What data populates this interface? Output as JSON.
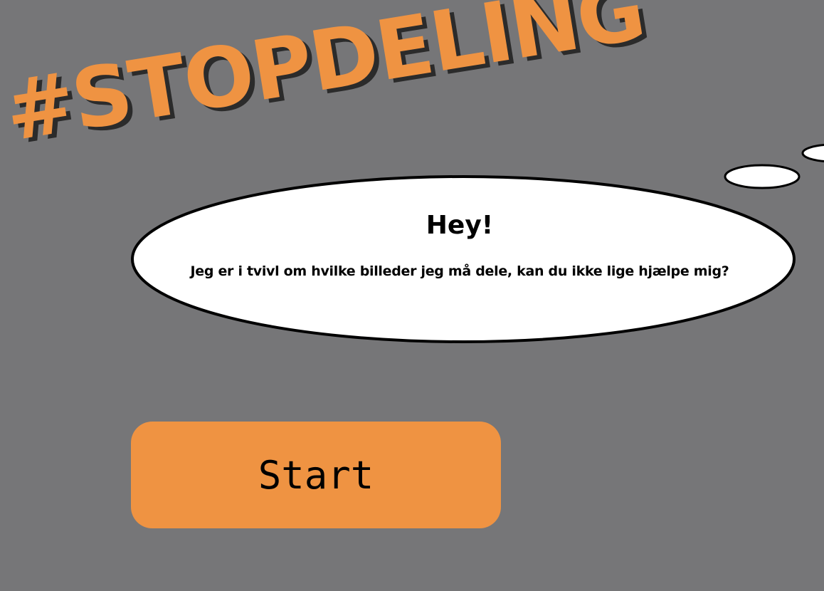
{
  "headline": "#STOPDELING",
  "speech_bubble": {
    "title": "Hey!",
    "message": "Jeg er i tvivl om hvilke billeder jeg må dele, kan du ikke lige hjælpe mig?"
  },
  "start_button": {
    "label": "Start"
  },
  "colors": {
    "background": "#767678",
    "accent_orange": "#ef9342",
    "headline_shadow": "#2b2b2b",
    "bubble_fill": "#ffffff",
    "bubble_outline": "#000000"
  }
}
